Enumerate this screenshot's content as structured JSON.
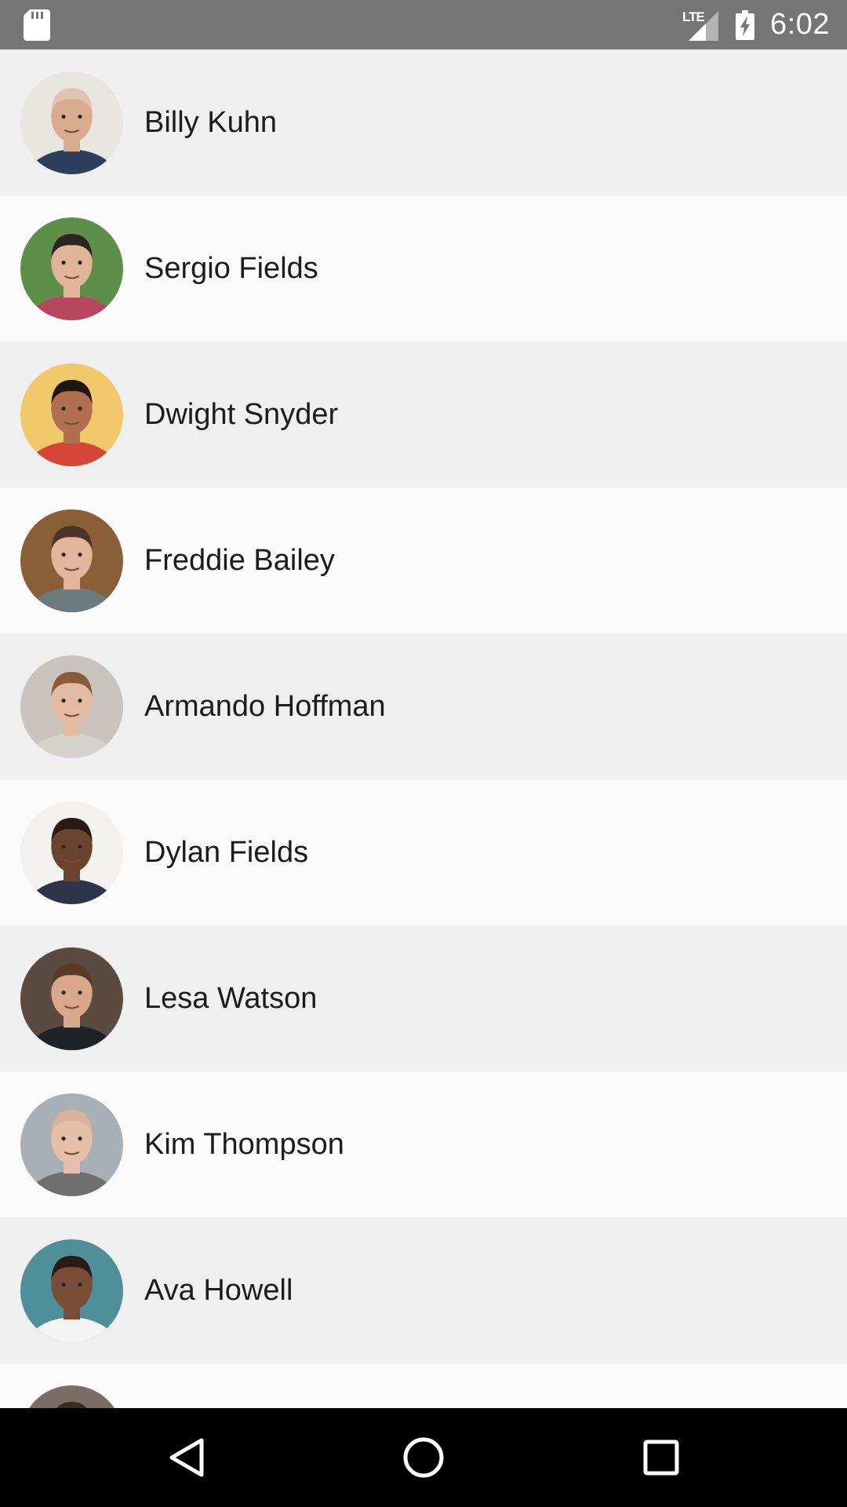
{
  "status_bar": {
    "time": "6:02",
    "network_label": "LTE",
    "left_icon": "sd-card-icon",
    "signal_icon": "signal-icon",
    "battery_icon": "battery-charging-icon"
  },
  "contacts": [
    {
      "name": "Billy Kuhn",
      "avatar": {
        "bg": "#e9e6e2",
        "skin": "#d9ab8f",
        "hair": "#e0c3b0",
        "shirt": "#2c3e5c"
      }
    },
    {
      "name": "Sergio Fields",
      "avatar": {
        "bg": "#5e8f4a",
        "skin": "#e2b59a",
        "hair": "#2d2521",
        "shirt": "#b8475e"
      }
    },
    {
      "name": "Dwight Snyder",
      "avatar": {
        "bg": "#f1c96a",
        "skin": "#b07050",
        "hair": "#1f1612",
        "shirt": "#d64535"
      }
    },
    {
      "name": "Freddie Bailey",
      "avatar": {
        "bg": "#8a5f37",
        "skin": "#e3b59b",
        "hair": "#4a3526",
        "shirt": "#6b7a7d"
      }
    },
    {
      "name": "Armando Hoffman",
      "avatar": {
        "bg": "#c9c4bf",
        "skin": "#e4bca4",
        "hair": "#8a5a3a",
        "shirt": "#d6d2cc"
      }
    },
    {
      "name": "Dylan Fields",
      "avatar": {
        "bg": "#f2f1ef",
        "skin": "#6b4430",
        "hair": "#2a1a12",
        "shirt": "#2f3448"
      }
    },
    {
      "name": "Lesa Watson",
      "avatar": {
        "bg": "#5a4a40",
        "skin": "#d9a88a",
        "hair": "#5a3a26",
        "shirt": "#1f2226"
      }
    },
    {
      "name": "Kim Thompson",
      "avatar": {
        "bg": "#a8b0b6",
        "skin": "#e6bfa8",
        "hair": "#d7b39d",
        "shirt": "#6e6e6e"
      }
    },
    {
      "name": "Ava Howell",
      "avatar": {
        "bg": "#4f8f9a",
        "skin": "#7a4e36",
        "hair": "#2a1c14",
        "shirt": "#f4f4f4"
      }
    },
    {
      "name": "",
      "avatar": {
        "bg": "#7a6e66",
        "skin": "#d8aa8e",
        "hair": "#3a2a20",
        "shirt": "#444444"
      }
    }
  ],
  "nav_bar": {
    "back_icon": "back-triangle-icon",
    "home_icon": "home-circle-icon",
    "recents_icon": "recents-square-icon"
  },
  "colors": {
    "status_bar_bg": "#757575",
    "row_shaded": "#efefef",
    "row_plain": "#fafafa",
    "nav_bar_bg": "#000000"
  }
}
